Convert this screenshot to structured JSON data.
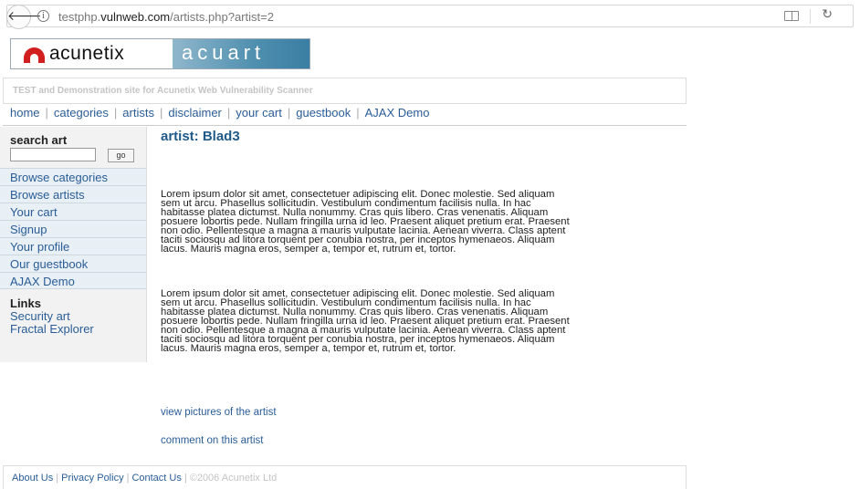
{
  "browser": {
    "back_glyph": "🡐",
    "info_glyph": "i",
    "url_prefix": "testphp.",
    "url_domain": "vulnweb.com",
    "url_path": "/artists.php?artist=2",
    "reload_glyph": "↻"
  },
  "logo": {
    "left_text": "acunetix",
    "right_text": "acuart"
  },
  "tagline": "TEST and Demonstration site for Acunetix Web Vulnerability Scanner",
  "topnav": [
    {
      "label": "home"
    },
    {
      "label": "categories"
    },
    {
      "label": "artists"
    },
    {
      "label": "disclaimer"
    },
    {
      "label": "your cart"
    },
    {
      "label": "guestbook"
    },
    {
      "label": "AJAX Demo"
    }
  ],
  "sidebar": {
    "search_label": "search art",
    "go_label": "go",
    "links": [
      {
        "label": "Browse categories"
      },
      {
        "label": "Browse artists"
      },
      {
        "label": "Your cart"
      },
      {
        "label": "Signup"
      },
      {
        "label": "Your profile"
      },
      {
        "label": "Our guestbook"
      },
      {
        "label": "AJAX Demo"
      }
    ],
    "links_heading": "Links",
    "external_links": [
      {
        "label": "Security art"
      },
      {
        "label": "Fractal Explorer"
      }
    ]
  },
  "content": {
    "title": "artist: Blad3",
    "paragraph_lines": [
      "Lorem ipsum dolor sit amet, consectetuer adipiscing elit. Donec molestie. Sed aliquam",
      "sem ut arcu. Phasellus sollicitudin. Vestibulum condimentum facilisis nulla. In hac",
      "habitasse platea dictumst. Nulla nonummy. Cras quis libero. Cras venenatis. Aliquam",
      "posuere lobortis pede. Nullam fringilla urna id leo. Praesent aliquet pretium erat. Praesent",
      "non odio. Pellentesque a magna a mauris vulputate lacinia. Aenean viverra. Class aptent",
      "taciti sociosqu ad litora torquent per conubia nostra, per inceptos hymenaeos. Aliquam",
      "lacus. Mauris magna eros, semper a, tempor et, rutrum et, tortor."
    ],
    "view_pictures_label": "view pictures of the artist",
    "comment_label": "comment on this artist"
  },
  "footer": {
    "about": "About Us",
    "privacy": "Privacy Policy",
    "contact": "Contact Us",
    "copyright": "©2006 Acunetix Ltd"
  }
}
